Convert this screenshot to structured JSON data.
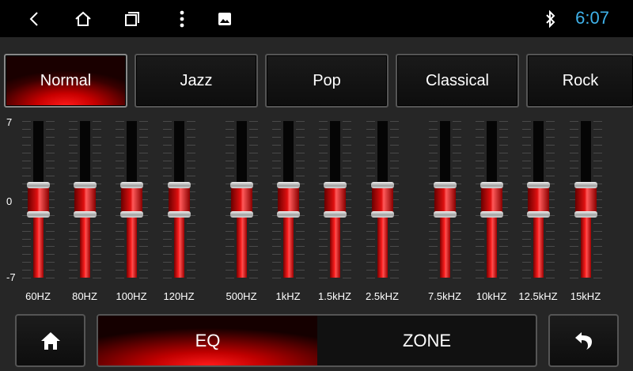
{
  "status": {
    "time": "6:07",
    "icons": [
      "back-icon",
      "home-icon",
      "recents-icon",
      "more-vert-icon",
      "image-icon",
      "bluetooth-icon"
    ]
  },
  "presets": [
    {
      "label": "Normal",
      "active": true
    },
    {
      "label": "Jazz",
      "active": false
    },
    {
      "label": "Pop",
      "active": false
    },
    {
      "label": "Classical",
      "active": false
    },
    {
      "label": "Rock",
      "active": false
    }
  ],
  "eq": {
    "scale_top": "7",
    "scale_mid": "0",
    "scale_bottom": "-7",
    "bands": [
      {
        "label": "60HZ",
        "value": 0
      },
      {
        "label": "80HZ",
        "value": 0
      },
      {
        "label": "100HZ",
        "value": 0
      },
      {
        "label": "120HZ",
        "value": 0
      },
      {
        "label": "500HZ",
        "value": 0
      },
      {
        "label": "1kHZ",
        "value": 0
      },
      {
        "label": "1.5kHZ",
        "value": 0
      },
      {
        "label": "2.5kHZ",
        "value": 0
      },
      {
        "label": "7.5kHZ",
        "value": 0
      },
      {
        "label": "10kHZ",
        "value": 0
      },
      {
        "label": "12.5kHZ",
        "value": 0
      },
      {
        "label": "15kHZ",
        "value": 0
      }
    ]
  },
  "bottom": {
    "tabs": [
      {
        "label": "EQ",
        "active": true
      },
      {
        "label": "ZONE",
        "active": false
      }
    ],
    "home_icon": "home-icon",
    "back_icon": "undo-icon"
  },
  "colors": {
    "accent_red": "#ff1a1a",
    "clock_blue": "#3fb2ea"
  }
}
